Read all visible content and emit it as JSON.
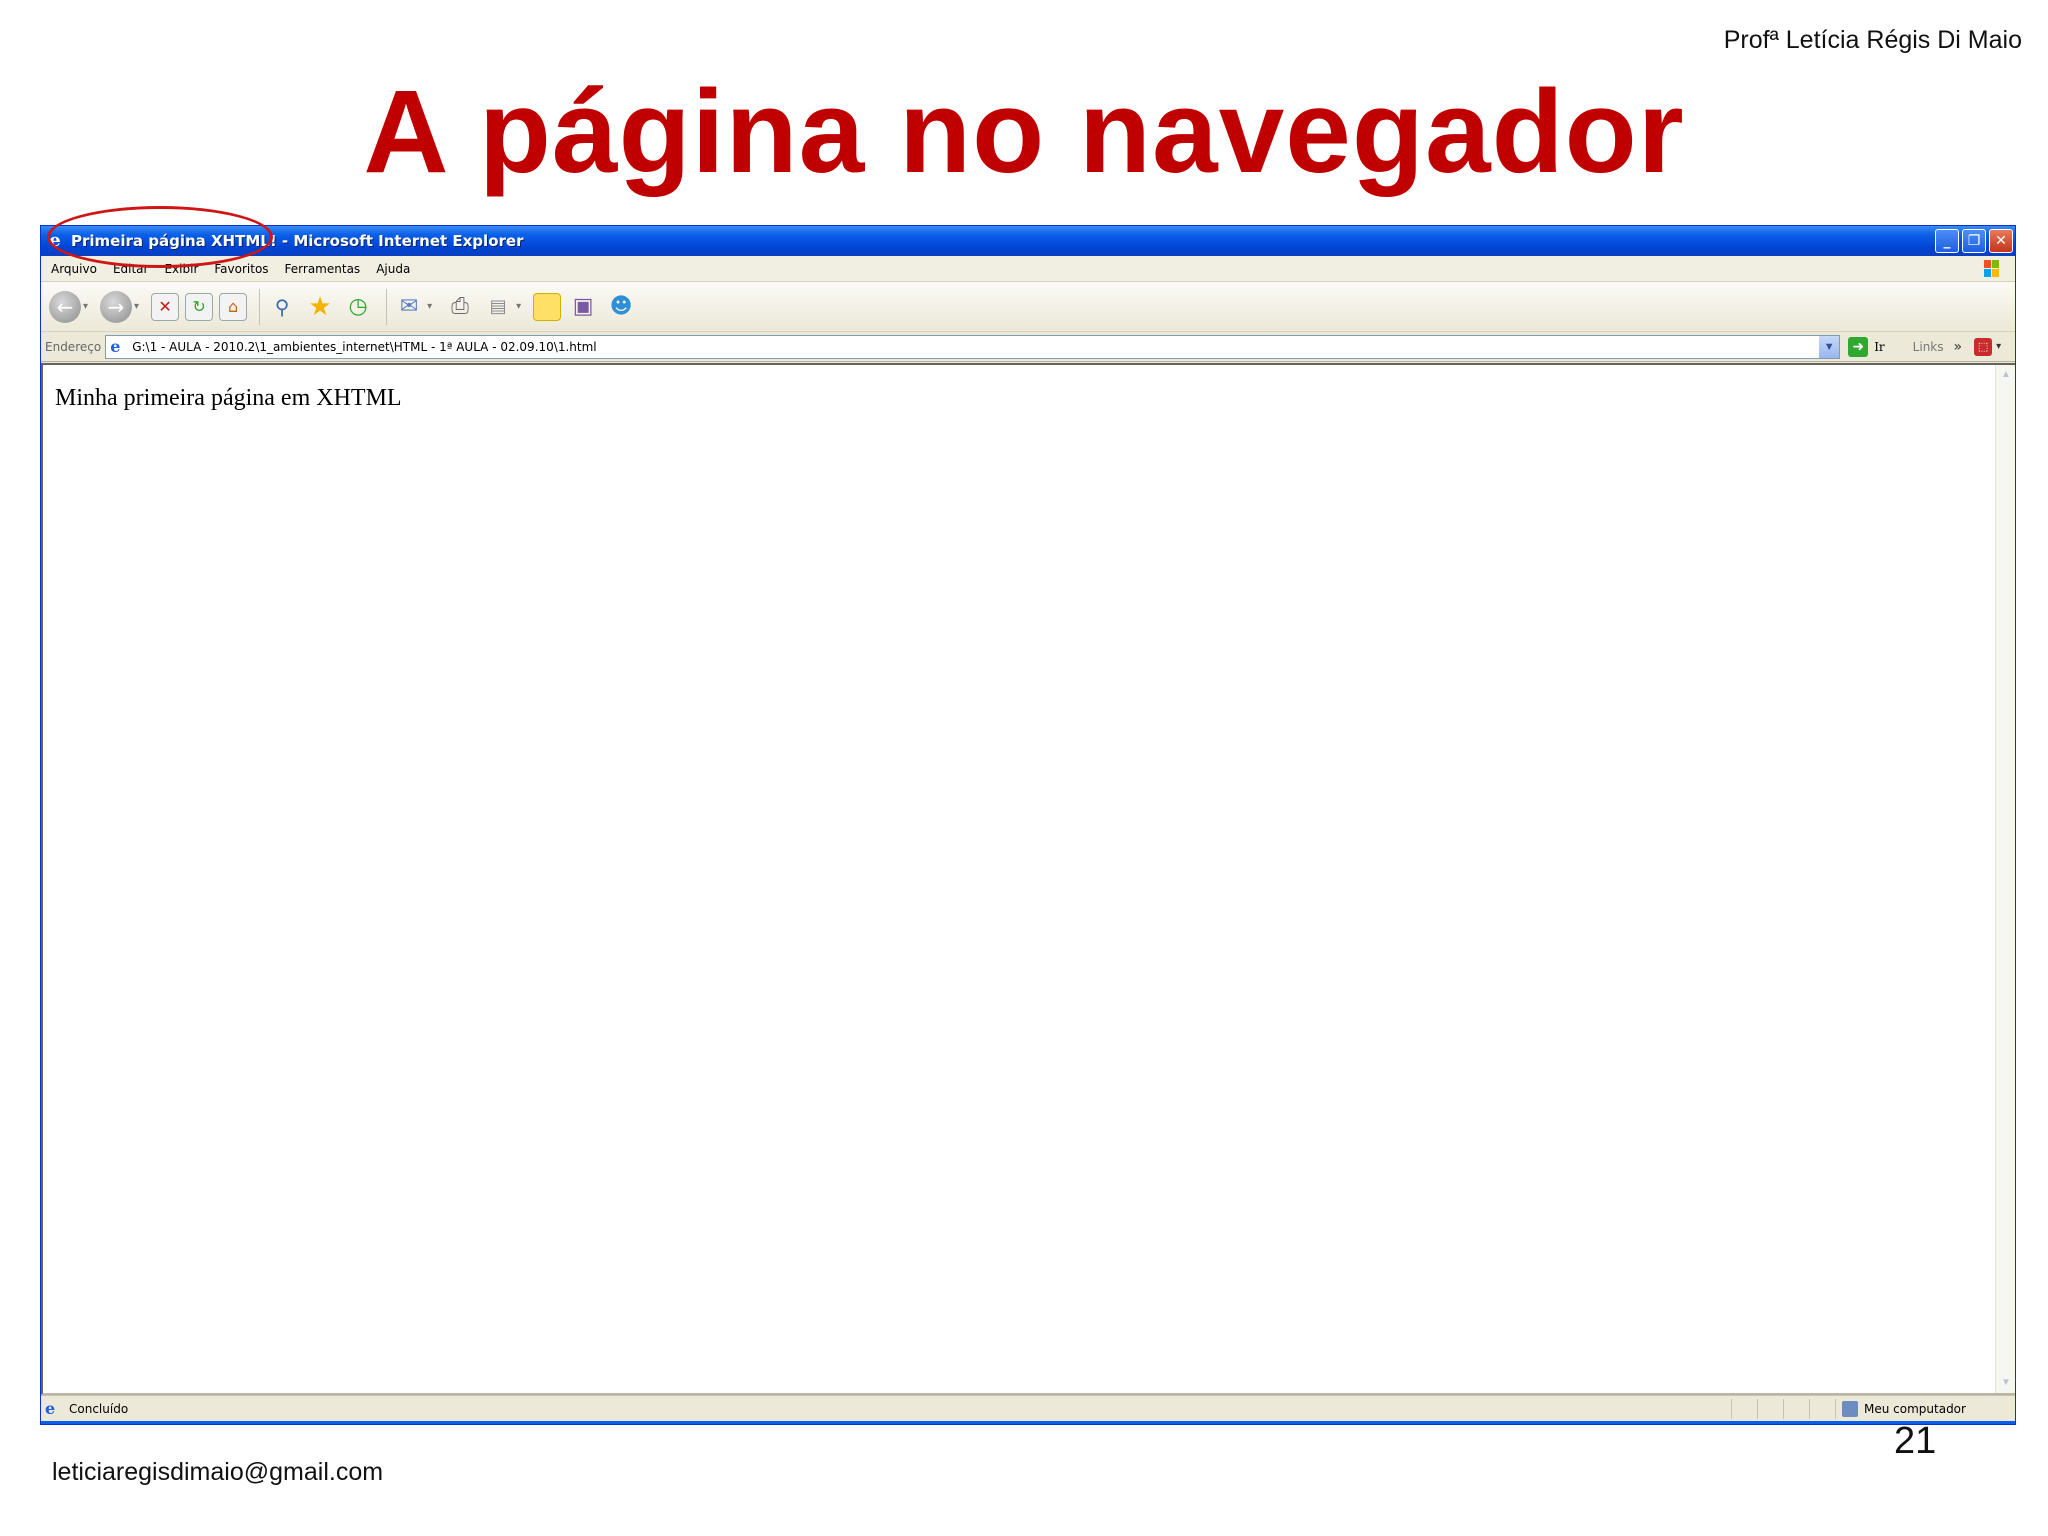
{
  "slide": {
    "author": "Profª Letícia Régis Di Maio",
    "title": "A página no navegador",
    "email": "leticiaregisdimaio@gmail.com",
    "page_number": "21"
  },
  "window": {
    "title": "Primeira página XHTML! - Microsoft Internet Explorer",
    "buttons": {
      "minimize": "_",
      "restore": "❐",
      "close": "✕"
    }
  },
  "menu": [
    "Arquivo",
    "Editar",
    "Exibir",
    "Favoritos",
    "Ferramentas",
    "Ajuda"
  ],
  "address": {
    "label": "Endereço",
    "value": "G:\\1 - AULA - 2010.2\\1_ambientes_internet\\HTML - 1ª AULA - 02.09.10\\1.html",
    "go_label": "Ir",
    "links_label": "Links",
    "links_chevron": "»"
  },
  "page": {
    "body_text": "Minha primeira página em XHTML"
  },
  "status": {
    "text": "Concluído",
    "zone": "Meu computador"
  },
  "colors": {
    "title_red": "#c00000",
    "xp_blue": "#0a5fe8",
    "highlight": "#d01515"
  }
}
